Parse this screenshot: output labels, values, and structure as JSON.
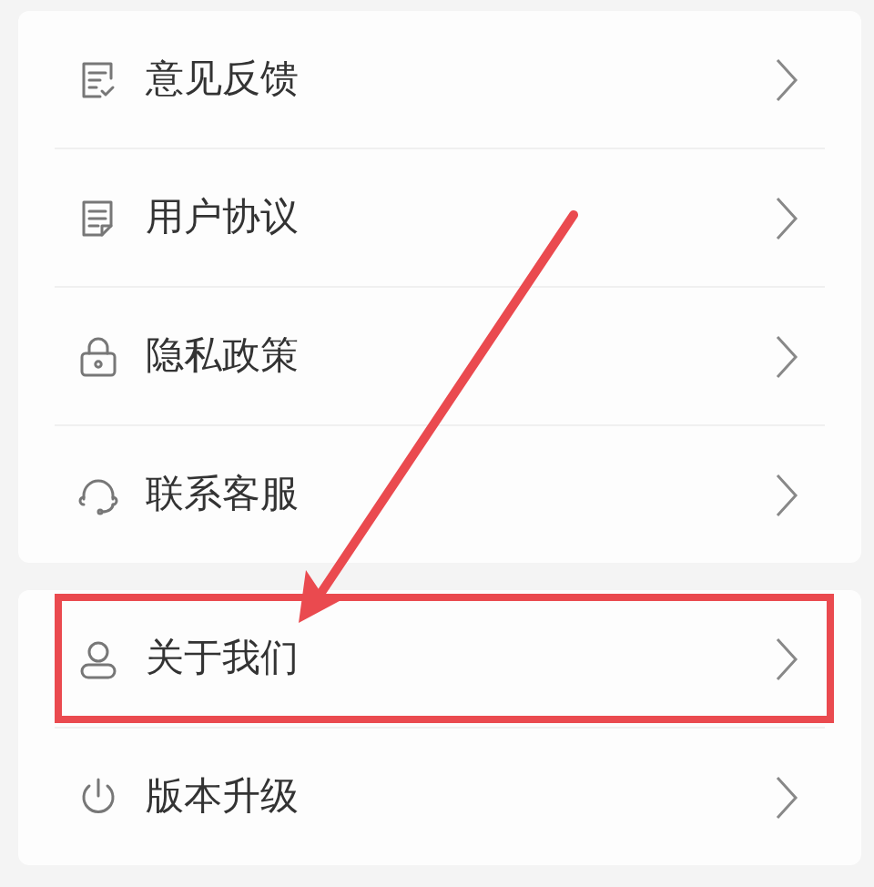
{
  "groups": [
    {
      "items": [
        {
          "label": "意见反馈",
          "highlighted": false
        },
        {
          "label": "用户协议",
          "highlighted": false
        },
        {
          "label": "隐私政策",
          "highlighted": false
        },
        {
          "label": "联系客服",
          "highlighted": false
        }
      ]
    },
    {
      "items": [
        {
          "label": "关于我们",
          "highlighted": true
        },
        {
          "label": "版本升级",
          "highlighted": false
        }
      ]
    }
  ]
}
